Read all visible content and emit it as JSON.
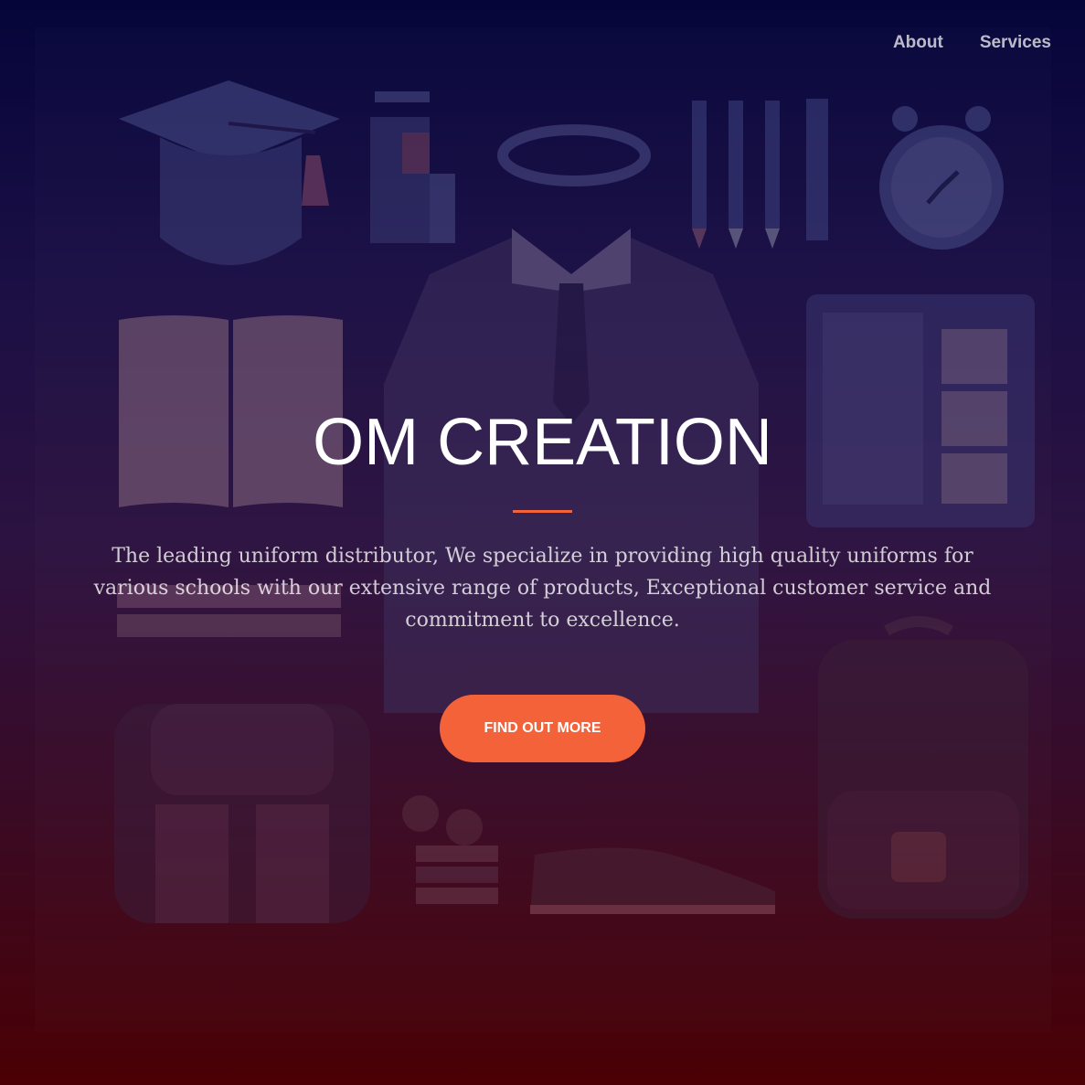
{
  "nav": {
    "items": [
      {
        "label": "About"
      },
      {
        "label": "Services"
      }
    ]
  },
  "hero": {
    "title": "OM CREATION",
    "tagline": "The leading uniform distributor, We specialize in providing high quality uniforms for various schools with our extensive range of products, Exceptional customer service and commitment to excellence.",
    "cta_label": "FIND OUT MORE"
  },
  "colors": {
    "accent": "#f4623a",
    "bg_top": "#05053a",
    "bg_bottom": "#4a0004"
  },
  "background_icons": [
    "graduation-cap-icon",
    "ruler-box-icon",
    "headband-icon",
    "pens-icon",
    "alarm-clock-icon",
    "open-book-icon",
    "blazer-icon",
    "tablet-icon",
    "backpack-icon",
    "apples-books-icon",
    "sneaker-icon",
    "school-bag-icon"
  ]
}
